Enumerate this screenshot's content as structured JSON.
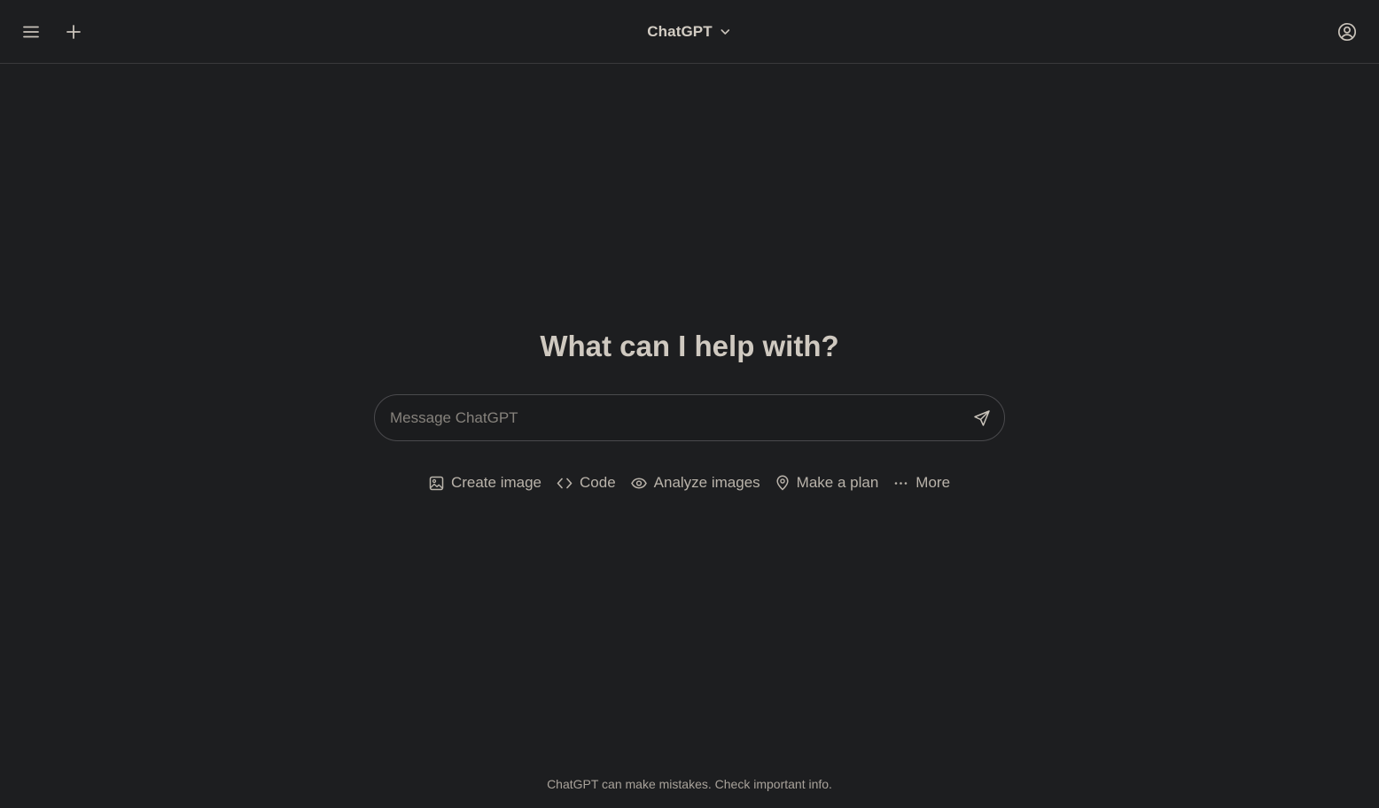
{
  "header": {
    "model_name": "ChatGPT",
    "icons": {
      "menu": "hamburger-menu-icon",
      "new_chat": "plus-icon",
      "model_dropdown": "chevron-down-icon",
      "account": "user-circle-icon"
    }
  },
  "main": {
    "headline": "What can I help with?",
    "composer": {
      "placeholder": "Message ChatGPT",
      "value": "",
      "send_icon": "send-icon"
    },
    "suggestions": [
      {
        "label": "Create image",
        "icon": "image-icon"
      },
      {
        "label": "Code",
        "icon": "code-icon"
      },
      {
        "label": "Analyze images",
        "icon": "eye-icon"
      },
      {
        "label": "Make a plan",
        "icon": "map-pin-icon"
      },
      {
        "label": "More",
        "icon": "ellipsis-icon"
      }
    ]
  },
  "footer": {
    "disclaimer": "ChatGPT can make mistakes. Check important info."
  },
  "colors": {
    "background": "#1d1e20",
    "text": "#c9c3ba",
    "border": "#3a3a3c"
  }
}
